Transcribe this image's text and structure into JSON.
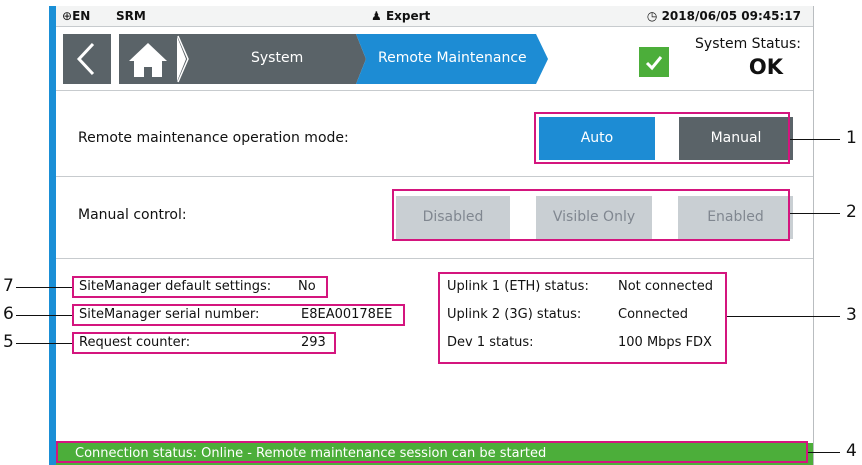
{
  "status_bar": {
    "language": "EN",
    "app": "SRM",
    "user": "Expert",
    "datetime": "2018/06/05 09:45:17"
  },
  "nav": {
    "crumbs": [
      "System",
      "Remote Maintenance"
    ],
    "system_status_label": "System Status:",
    "system_status_value": "OK"
  },
  "mode": {
    "label": "Remote maintenance operation mode:",
    "auto": "Auto",
    "manual": "Manual",
    "selected": "Auto"
  },
  "manual_control": {
    "label": "Manual control:",
    "options": [
      "Disabled",
      "Visible Only",
      "Enabled"
    ]
  },
  "sitemanager": {
    "default_settings_label": "SiteManager default settings:",
    "default_settings_value": "No",
    "serial_label": "SiteManager serial number:",
    "serial_value": "E8EA00178EE",
    "counter_label": "Request counter:",
    "counter_value": "293"
  },
  "uplinks": [
    {
      "label": "Uplink 1 (ETH) status:",
      "value": "Not connected"
    },
    {
      "label": "Uplink 2 (3G) status:",
      "value": "Connected"
    },
    {
      "label": "Dev 1 status:",
      "value": "100 Mbps FDX"
    }
  ],
  "connection_status": "Connection status: Online - Remote maintenance session can be started",
  "callouts": [
    "1",
    "2",
    "3",
    "4",
    "5",
    "6",
    "7"
  ],
  "colors": {
    "accent_blue": "#1d8cd4",
    "dark_grey": "#5a6368",
    "ok_green": "#4cae3a",
    "highlight_pink": "#d4157e"
  }
}
